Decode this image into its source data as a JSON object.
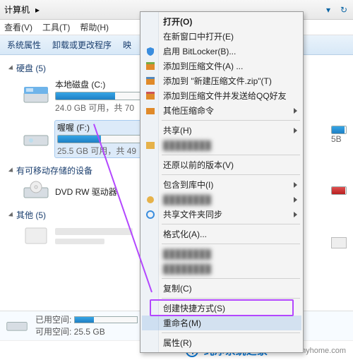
{
  "titlebar": {
    "path": "计算机",
    "chev": "▸"
  },
  "menubar": {
    "view": "查看(V)",
    "tools": "工具(T)",
    "help": "帮助(H)"
  },
  "toolbar": {
    "sys_props": "系统属性",
    "uninstall": "卸载或更改程序",
    "map_cut": "映"
  },
  "sections": {
    "hdd": "硬盘 (5)",
    "removable": "有可移动存储的设备",
    "other": "其他 (5)"
  },
  "drives": {
    "c": {
      "name": "本地磁盘 (C:)",
      "sub": "24.0 GB 可用，共 70",
      "fill_pct": 66
    },
    "f": {
      "name": "喔喔 (F:)",
      "sub": "25.5 GB 可用，共 49",
      "fill_pct": 48
    },
    "side_cut": "5B",
    "dvd": "DVD RW 驱动器"
  },
  "status": {
    "line1_label": "已用空间:",
    "line2": "可用空间: 25.5 GB"
  },
  "watermark": {
    "brand": "纯净系统之家",
    "url": "www.kzmyhome.com"
  },
  "ctx": {
    "open": "打开(O)",
    "open_new": "在新窗口中打开(E)",
    "bitlocker": "启用 BitLocker(B)...",
    "add_zip": "添加到压缩文件(A) ...",
    "add_zip_named": "添加到 \"新建压缩文件.zip\"(T)",
    "zip_qq": "添加到压缩文件并发送给QQ好友",
    "other_zip": "其他压缩命令",
    "share": "共享(H)",
    "blur1": "████████",
    "restore": "还原以前的版本(V)",
    "include": "包含到库中(I)",
    "blur2": "████████",
    "sync": "共享文件夹同步",
    "format": "格式化(A)...",
    "blur3": "████████",
    "blur4": "████████",
    "copy": "复制(C)",
    "shortcut": "创建快捷方式(S)",
    "rename": "重命名(M)",
    "props": "属性(R)"
  }
}
